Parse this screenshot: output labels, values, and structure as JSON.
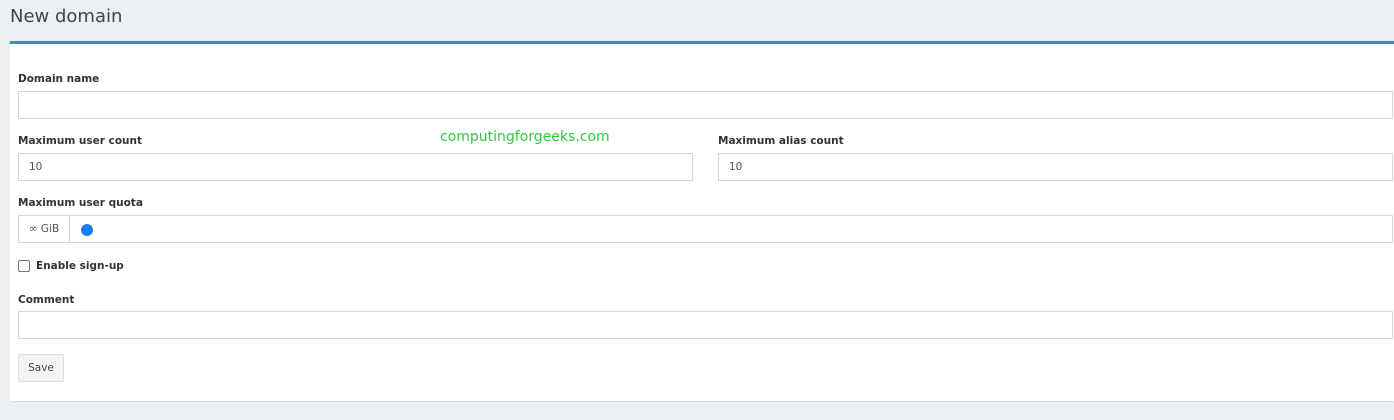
{
  "page": {
    "title": "New domain"
  },
  "form": {
    "domain_name": {
      "label": "Domain name",
      "value": ""
    },
    "max_user_count": {
      "label": "Maximum user count",
      "value": "10"
    },
    "max_alias_count": {
      "label": "Maximum alias count",
      "value": "10"
    },
    "max_user_quota": {
      "label": "Maximum user quota",
      "addon": "∞ GiB",
      "slider_value": 0
    },
    "enable_signup": {
      "label": "Enable sign-up",
      "checked": false
    },
    "comment": {
      "label": "Comment",
      "value": ""
    },
    "save_label": "Save"
  },
  "watermark": "computingforgeeks.com",
  "colors": {
    "accent": "#3c8dbc",
    "slider": "#1a7cf7"
  }
}
